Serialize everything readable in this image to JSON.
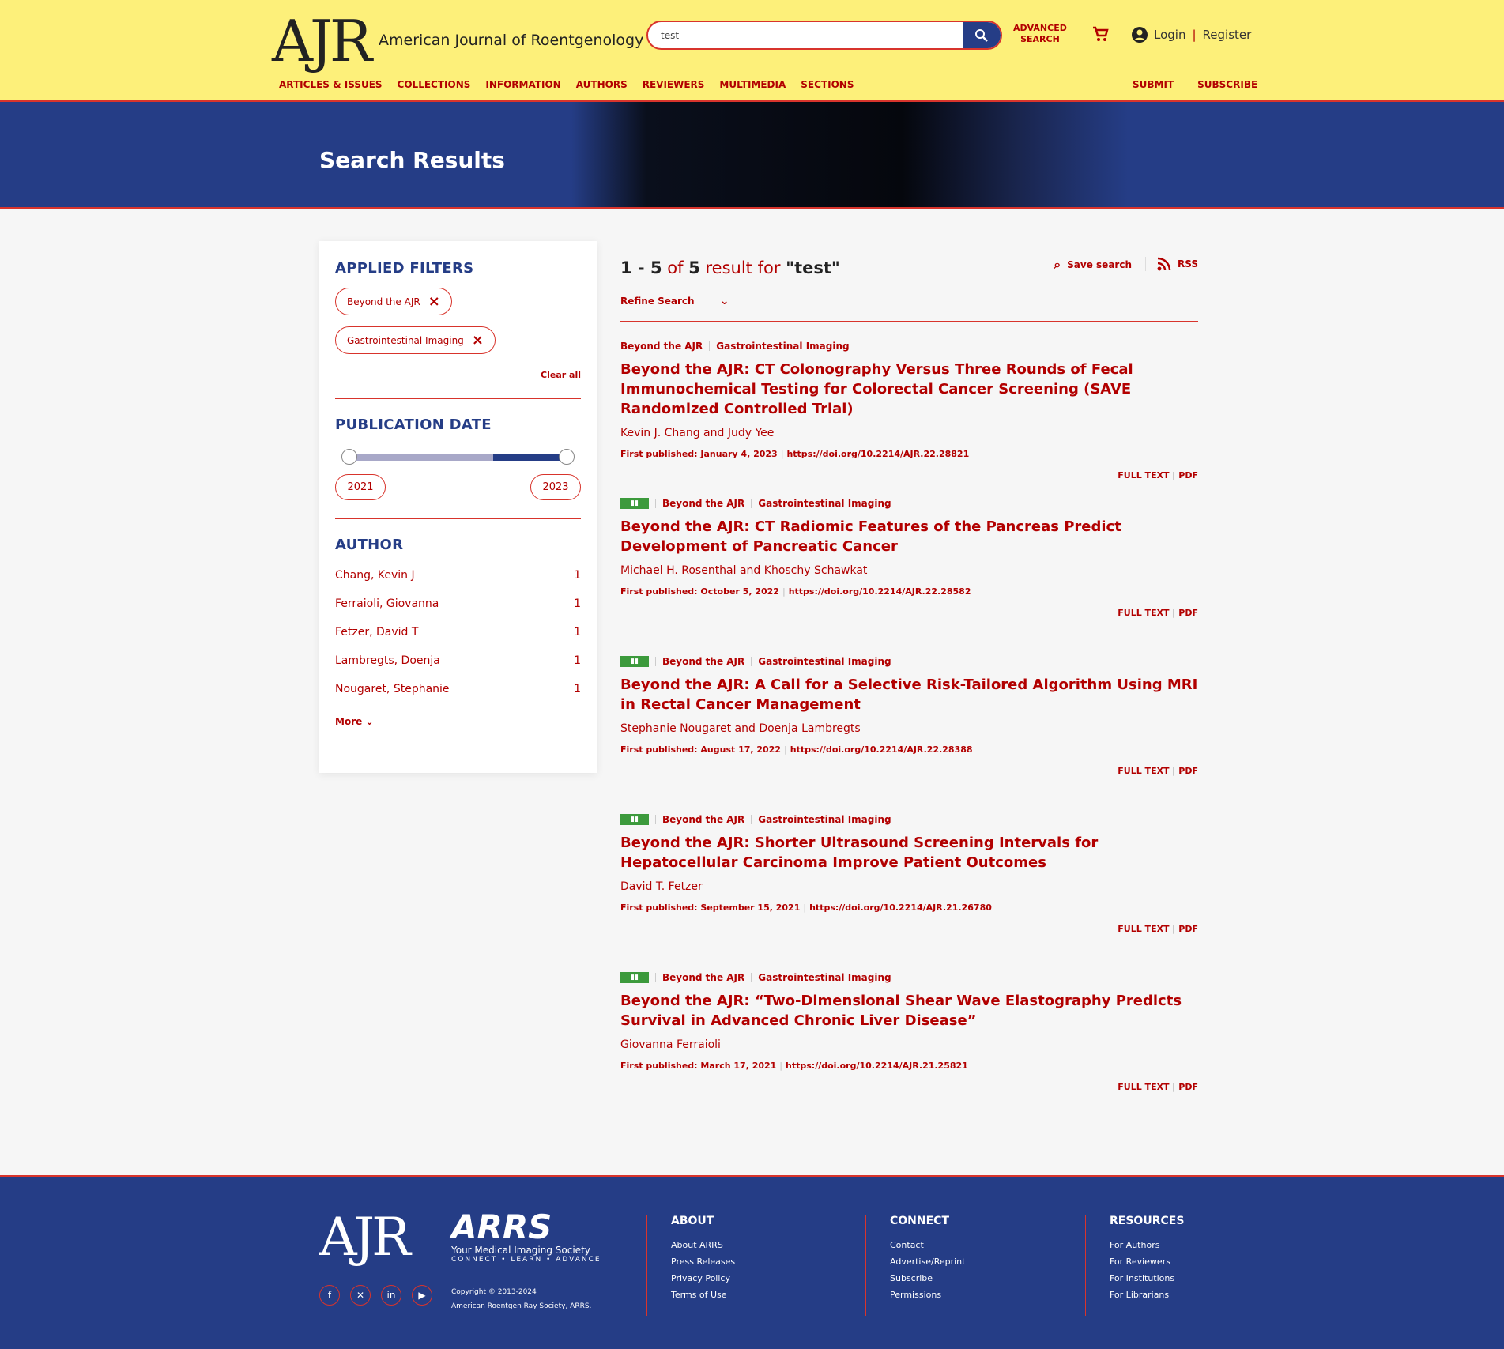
{
  "header": {
    "logo": "AJR",
    "journal": "American Journal of Roentgenology",
    "search_value": "test",
    "advanced_line1": "ADVANCED",
    "advanced_line2": "SEARCH",
    "login": "Login",
    "register": "Register",
    "nav": [
      "ARTICLES & ISSUES",
      "COLLECTIONS",
      "INFORMATION",
      "AUTHORS",
      "REVIEWERS",
      "MULTIMEDIA",
      "SECTIONS"
    ],
    "submit": "SUBMIT",
    "subscribe": "SUBSCRIBE"
  },
  "banner": {
    "title": "Search Results"
  },
  "sidebar": {
    "applied_title": "APPLIED FILTERS",
    "chips": [
      "Beyond the AJR",
      "Gastrointestinal Imaging"
    ],
    "clear_all": "Clear all",
    "pubdate_title": "PUBLICATION DATE",
    "year_from": "2021",
    "year_to": "2023",
    "author_title": "AUTHOR",
    "authors": [
      {
        "name": "Chang, Kevin J",
        "count": "1"
      },
      {
        "name": "Ferraioli, Giovanna",
        "count": "1"
      },
      {
        "name": "Fetzer, David T",
        "count": "1"
      },
      {
        "name": "Lambregts, Doenja",
        "count": "1"
      },
      {
        "name": "Nougaret, Stephanie",
        "count": "1"
      }
    ],
    "more": "More"
  },
  "results": {
    "range": "1 - 5",
    "of": "of",
    "total": "5",
    "label": "result for",
    "query": "\"test\"",
    "save_search": "Save search",
    "rss": "RSS",
    "refine": "Refine Search",
    "full_text": "FULL TEXT",
    "pdf": "PDF",
    "items": [
      {
        "section": "Beyond the AJR",
        "topic": "Gastrointestinal Imaging",
        "title": "Beyond the AJR: CT Colonography Versus Three Rounds of Fecal Immunochemical Testing for Colorectal Cancer Screening (SAVE Randomized Controlled Trial)",
        "authors": "Kevin J. Chang and Judy Yee",
        "date": "First published: January 4, 2023",
        "doi": "https://doi.org/10.2214/AJR.22.28821"
      },
      {
        "section": "Beyond the AJR",
        "topic": "Gastrointestinal Imaging",
        "title": "Beyond the AJR: CT Radiomic Features of the Pancreas Predict Development of Pancreatic Cancer",
        "authors": "Michael H. Rosenthal and Khoschy Schawkat",
        "date": "First published: October 5, 2022",
        "doi": "https://doi.org/10.2214/AJR.22.28582"
      },
      {
        "section": "Beyond the AJR",
        "topic": "Gastrointestinal Imaging",
        "title": "Beyond the AJR: A Call for a Selective Risk-Tailored Algorithm Using MRI in Rectal Cancer Management",
        "authors": "Stephanie Nougaret and Doenja Lambregts",
        "date": "First published: August 17, 2022",
        "doi": "https://doi.org/10.2214/AJR.22.28388"
      },
      {
        "section": "Beyond the AJR",
        "topic": "Gastrointestinal Imaging",
        "title": "Beyond the AJR: Shorter Ultrasound Screening Intervals for Hepatocellular Carcinoma Improve Patient Outcomes",
        "authors": "David T. Fetzer",
        "date": "First published: September 15, 2021",
        "doi": "https://doi.org/10.2214/AJR.21.26780"
      },
      {
        "section": "Beyond the AJR",
        "topic": "Gastrointestinal Imaging",
        "title": "Beyond the AJR: “Two-Dimensional Shear Wave Elastography Predicts Survival in Advanced Chronic Liver Disease”",
        "authors": "Giovanna Ferraioli",
        "date": "First published: March 17, 2021",
        "doi": "https://doi.org/10.2214/AJR.21.25821"
      }
    ]
  },
  "footer": {
    "logo": "AJR",
    "arrs": "ARRS",
    "arrs_tag": "Your Medical Imaging Society",
    "arrs_sub": "CONNECT • LEARN • ADVANCE",
    "copyright1": "Copyright © 2013-2024",
    "copyright2": "American Roentgen Ray Society, ARRS.",
    "about_title": "ABOUT",
    "about": [
      "About ARRS",
      "Press Releases",
      "Privacy Policy",
      "Terms of Use"
    ],
    "connect_title": "CONNECT",
    "connect": [
      "Contact",
      "Advertise/Reprint",
      "Subscribe",
      "Permissions"
    ],
    "resources_title": "RESOURCES",
    "resources": [
      "For Authors",
      "For Reviewers",
      "For Institutions",
      "For Librarians"
    ]
  },
  "colors": {
    "accent": "#b20000",
    "navy": "#253d86",
    "header_bg": "#fdf07a"
  }
}
